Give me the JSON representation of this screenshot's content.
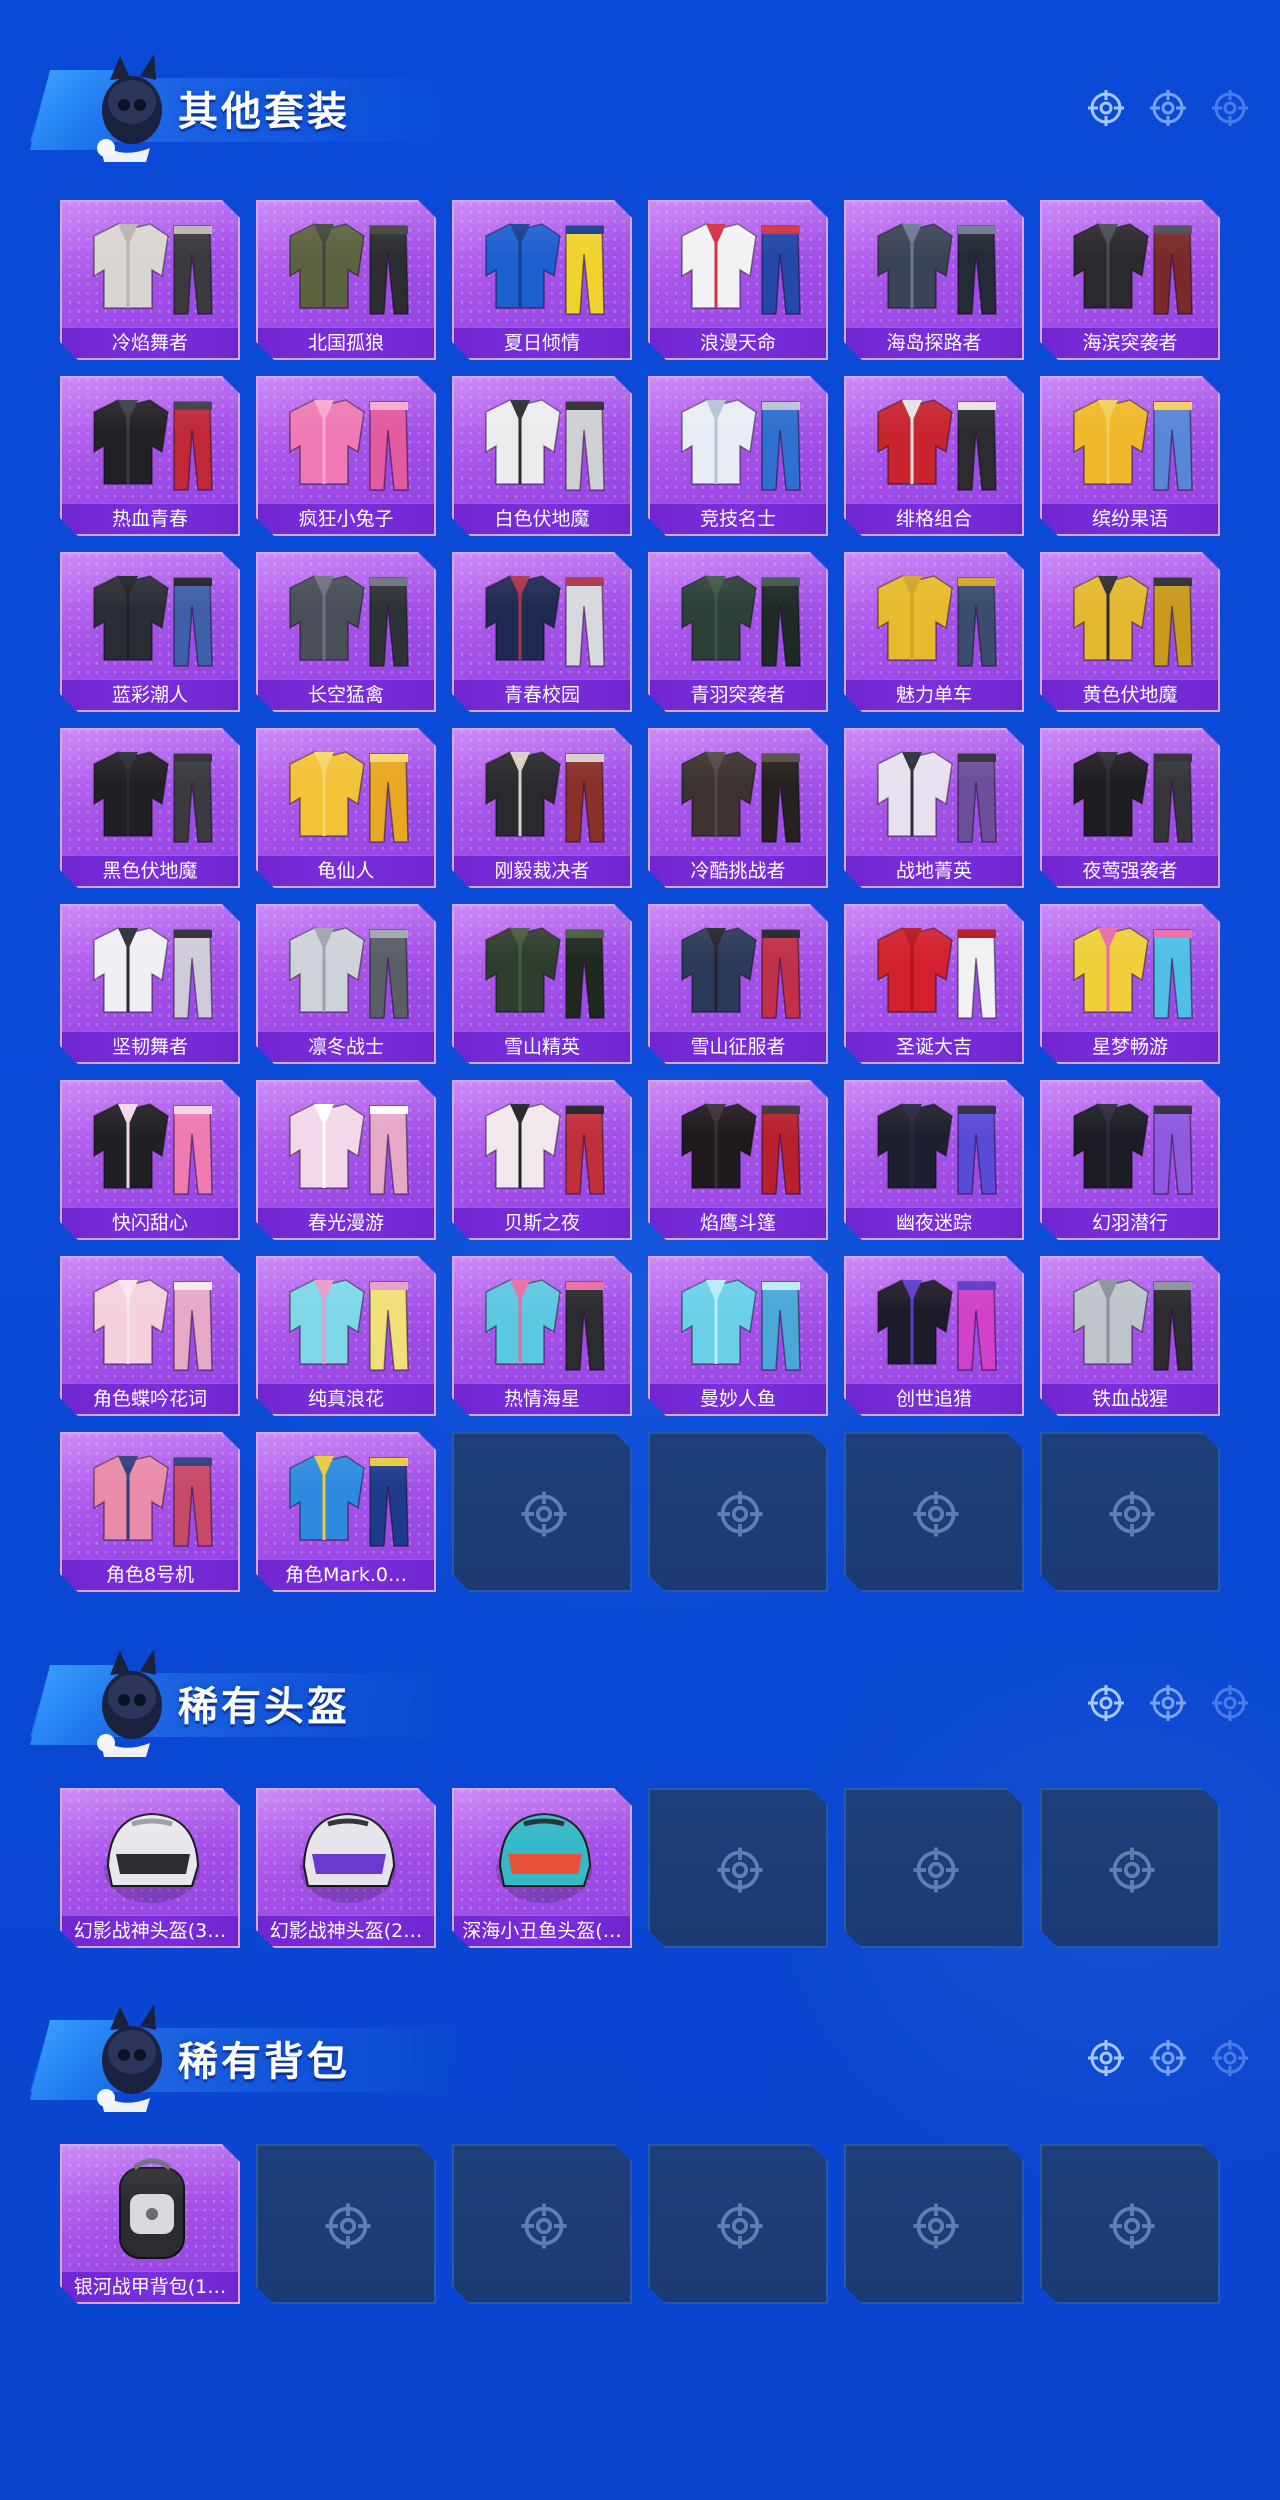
{
  "sections": [
    {
      "title": "其他套装",
      "items": [
        {
          "label": "冷焰舞者",
          "palette": [
            "#d9d6d2",
            "#3a3a3f",
            "#b8b4b0"
          ]
        },
        {
          "label": "北国孤狼",
          "palette": [
            "#5b6340",
            "#2b2d30",
            "#40443a"
          ]
        },
        {
          "label": "夏日倾情",
          "palette": [
            "#1e5fd0",
            "#f1d22f",
            "#163b8f"
          ]
        },
        {
          "label": "浪漫天命",
          "palette": [
            "#f2f2f4",
            "#2447a8",
            "#d32f3f"
          ]
        },
        {
          "label": "海岛探路者",
          "palette": [
            "#3b4456",
            "#242a36",
            "#6b7690"
          ]
        },
        {
          "label": "海滨突袭者",
          "palette": [
            "#2a2a2e",
            "#7a2a2a",
            "#4a4a52"
          ]
        },
        {
          "label": "热血青春",
          "palette": [
            "#222226",
            "#c0283a",
            "#3b3b40"
          ]
        },
        {
          "label": "疯狂小兔子",
          "palette": [
            "#ef7ab6",
            "#e25aa0",
            "#f6a8cf"
          ]
        },
        {
          "label": "白色伏地魔",
          "palette": [
            "#ececee",
            "#cfcfd4",
            "#2b2b30"
          ]
        },
        {
          "label": "竞技名士",
          "palette": [
            "#e8ecf4",
            "#2f6fcf",
            "#b8c2d6"
          ]
        },
        {
          "label": "绯格组合",
          "palette": [
            "#c8242e",
            "#2b2b30",
            "#e4e4e8"
          ]
        },
        {
          "label": "缤纷果语",
          "palette": [
            "#f0b82a",
            "#5a86d8",
            "#f2cf5a"
          ]
        },
        {
          "label": "蓝彩潮人",
          "palette": [
            "#2a2d36",
            "#3f5fa8",
            "#1f2026"
          ]
        },
        {
          "label": "长空猛禽",
          "palette": [
            "#4a4e58",
            "#2f3138",
            "#6d717c"
          ]
        },
        {
          "label": "青春校园",
          "palette": [
            "#1f2a52",
            "#d8d8de",
            "#a8324a"
          ]
        },
        {
          "label": "青羽突袭者",
          "palette": [
            "#2d4038",
            "#1e2a26",
            "#3c5448"
          ]
        },
        {
          "label": "魅力单车",
          "palette": [
            "#e8bb2e",
            "#3b4c6e",
            "#d1a226"
          ]
        },
        {
          "label": "黄色伏地魔",
          "palette": [
            "#e6b830",
            "#c99a1e",
            "#2b2b30"
          ]
        },
        {
          "label": "黑色伏地魔",
          "palette": [
            "#1f1f24",
            "#3a3a40",
            "#2a2a30"
          ]
        },
        {
          "label": "龟仙人",
          "palette": [
            "#f2c237",
            "#e9a824",
            "#f6d56a"
          ]
        },
        {
          "label": "刚毅裁决者",
          "palette": [
            "#2a2a2e",
            "#8a2f2a",
            "#d8d0c8"
          ]
        },
        {
          "label": "冷酷挑战者",
          "palette": [
            "#3a3330",
            "#25211f",
            "#524843"
          ]
        },
        {
          "label": "战地菁英",
          "palette": [
            "#e8e0ee",
            "#6b4f9a",
            "#2b2d34"
          ]
        },
        {
          "label": "夜莺强袭者",
          "palette": [
            "#1d1d22",
            "#35353c",
            "#2a2a30"
          ]
        },
        {
          "label": "坚韧舞者",
          "palette": [
            "#efeef2",
            "#cfcbd8",
            "#2b2b30"
          ]
        },
        {
          "label": "凛冬战士",
          "palette": [
            "#cfd2d8",
            "#5a5e66",
            "#9ea3ac"
          ]
        },
        {
          "label": "雪山精英",
          "palette": [
            "#2f3d2e",
            "#1f2920",
            "#46583f"
          ]
        },
        {
          "label": "雪山征服者",
          "palette": [
            "#2b3a5a",
            "#c0304a",
            "#202226"
          ]
        },
        {
          "label": "圣诞大吉",
          "palette": [
            "#d2202e",
            "#f2f2f4",
            "#b0141f"
          ]
        },
        {
          "label": "星梦畅游",
          "palette": [
            "#f0cf3a",
            "#4ec0e8",
            "#e86aa8"
          ]
        },
        {
          "label": "快闪甜心",
          "palette": [
            "#1f1f24",
            "#f07ab2",
            "#f2d6e4"
          ]
        },
        {
          "label": "春光漫游",
          "palette": [
            "#f2d8e8",
            "#e8a8c8",
            "#ffffff"
          ]
        },
        {
          "label": "贝斯之夜",
          "palette": [
            "#f0e8ea",
            "#c0303c",
            "#1f1f24"
          ]
        },
        {
          "label": "焰鹰斗篷",
          "palette": [
            "#1f1a1e",
            "#b8202e",
            "#3a2e34"
          ]
        },
        {
          "label": "幽夜迷踪",
          "palette": [
            "#1e1f2e",
            "#5a4ad8",
            "#2a2440"
          ]
        },
        {
          "label": "幻羽潜行",
          "palette": [
            "#1c1c26",
            "#8e5ae0",
            "#2c2838"
          ]
        },
        {
          "label": "角色蝶吟花词",
          "palette": [
            "#f4d0de",
            "#e8a8c8",
            "#f8e6ee"
          ]
        },
        {
          "label": "纯真浪花",
          "palette": [
            "#7ed8e8",
            "#f0e07a",
            "#e89ac8"
          ]
        },
        {
          "label": "热情海星",
          "palette": [
            "#5cc8e0",
            "#2b2b30",
            "#e86aa0"
          ]
        },
        {
          "label": "曼妙人鱼",
          "palette": [
            "#6ad0e8",
            "#4aa8d8",
            "#b8ecf6"
          ]
        },
        {
          "label": "创世追猎",
          "palette": [
            "#1c1c2a",
            "#d040c8",
            "#5a38c8"
          ]
        },
        {
          "label": "铁血战猩",
          "palette": [
            "#bfc4cc",
            "#2b2b30",
            "#8a9098"
          ]
        },
        {
          "label": "角色8号机",
          "palette": [
            "#e88aa8",
            "#c8486a",
            "#2b3a7a"
          ]
        },
        {
          "label": "角色Mark.0…",
          "palette": [
            "#2e8ae0",
            "#1f3a8a",
            "#e8c83a"
          ]
        }
      ],
      "empty_slots": 4
    },
    {
      "title": "稀有头盔",
      "items": [
        {
          "label": "幻影战神头盔(3…",
          "palette": [
            "#e8e8ec",
            "#2b2b30",
            "#9a9aa4"
          ]
        },
        {
          "label": "幻影战神头盔(2…",
          "palette": [
            "#e4e4ea",
            "#6a3ad0",
            "#2b2b30"
          ]
        },
        {
          "label": "深海小丑鱼头盔(…",
          "palette": [
            "#35b8c8",
            "#e8503a",
            "#1f2a30"
          ]
        }
      ],
      "empty_slots": 3
    },
    {
      "title": "稀有背包",
      "items": [
        {
          "label": "银河战甲背包(1…",
          "palette": [
            "#2b2b30",
            "#d8d8de",
            "#6a6a72"
          ]
        }
      ],
      "empty_slots": 5
    }
  ],
  "accent_colors": {
    "tile_purple": "#a552e8",
    "label_bar": "#7a2fdc",
    "empty_slot": "#1f3f7a",
    "background": "#0b4bd8"
  }
}
